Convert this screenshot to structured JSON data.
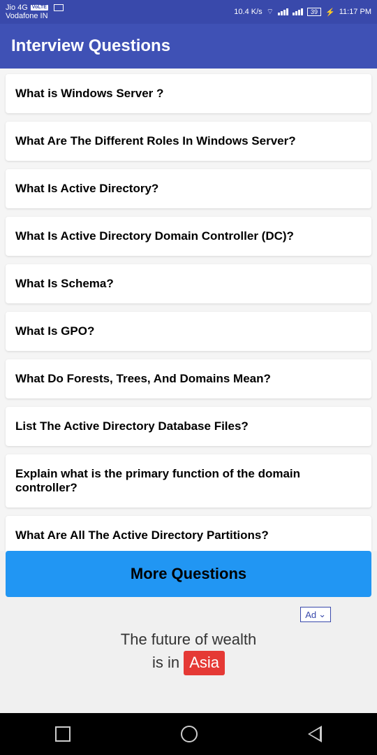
{
  "status": {
    "carrier1": "Jio 4G",
    "volte": "VoLTE",
    "carrier2": "Vodafone IN",
    "speed": "10.4 K/s",
    "battery": "39",
    "time": "11:17 PM"
  },
  "appbar": {
    "title": "Interview Questions"
  },
  "questions": [
    "What is Windows Server ?",
    "What Are The Different Roles In Windows Server?",
    "What Is Active Directory?",
    "What Is Active Directory Domain Controller (DC)?",
    "What Is Schema?",
    "What Is GPO?",
    "What Do Forests, Trees, And Domains Mean?",
    "List The Active Directory Database Files?",
    "Explain what is the primary function of the domain controller?",
    "What Are All The Active Directory Partitions?"
  ],
  "more_button": "More Questions",
  "ad": {
    "badge": "Ad",
    "line1": "The future of wealth",
    "line2_prefix": "is in",
    "line2_highlight": "Asia"
  }
}
